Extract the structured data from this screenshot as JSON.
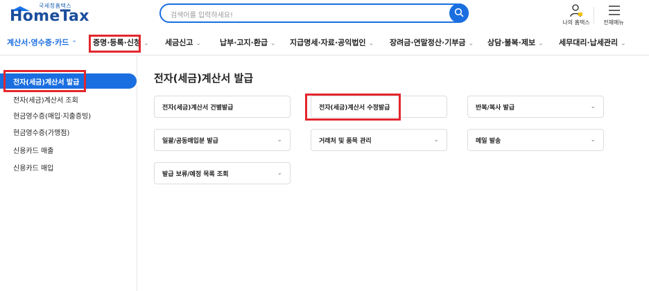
{
  "header": {
    "logo_small": "국세청홈택스",
    "logo_text": "HomeTax",
    "search_placeholder": "검색어를 입력하세요!",
    "my_hometax": "나의 홈택스",
    "all_menu": "전체메뉴"
  },
  "nav": {
    "items": [
      {
        "label": "계산서·영수증·카드",
        "active": true
      },
      {
        "label": "증명·등록·신청"
      },
      {
        "label": "세금신고"
      },
      {
        "label": "납부·고지·환급"
      },
      {
        "label": "지급명세·자료·공익법인"
      },
      {
        "label": "장려금·연말정산·기부금"
      },
      {
        "label": "상담·불복·제보"
      },
      {
        "label": "세무대리·납세관리"
      }
    ]
  },
  "sidebar": {
    "items": [
      {
        "label": "전자(세금)계산서 발급",
        "active": true
      },
      {
        "label": "전자(세금)계산서 조회"
      },
      {
        "label": "현금영수증(매입·지출증빙)"
      },
      {
        "label": "현금영수증(가맹점)"
      },
      {
        "label": "신용카드 매출"
      },
      {
        "label": "신용카드 매입"
      }
    ]
  },
  "main": {
    "title": "전자(세금)계산서 발급",
    "cards": [
      {
        "label": "전자(세금)계산서 건별발급",
        "has_chevron": false
      },
      {
        "label": "전자(세금)계산서 수정발급",
        "has_chevron": false
      },
      {
        "label": "반복/복사 발급",
        "has_chevron": true
      },
      {
        "label": "일괄/공동매입분 발급",
        "has_chevron": true
      },
      {
        "label": "거래처 및 품목 관리",
        "has_chevron": true
      },
      {
        "label": "메일 발송",
        "has_chevron": true
      },
      {
        "label": "발급 보류/예정 목록 조회",
        "has_chevron": true
      }
    ]
  },
  "icons": {
    "search": "search-icon",
    "user": "user-icon",
    "menu": "hamburger-icon",
    "chevron": "chevron-down-icon"
  },
  "colors": {
    "accent": "#1a6ee0",
    "logo": "#1a4d9c",
    "highlight": "#e2262c"
  }
}
